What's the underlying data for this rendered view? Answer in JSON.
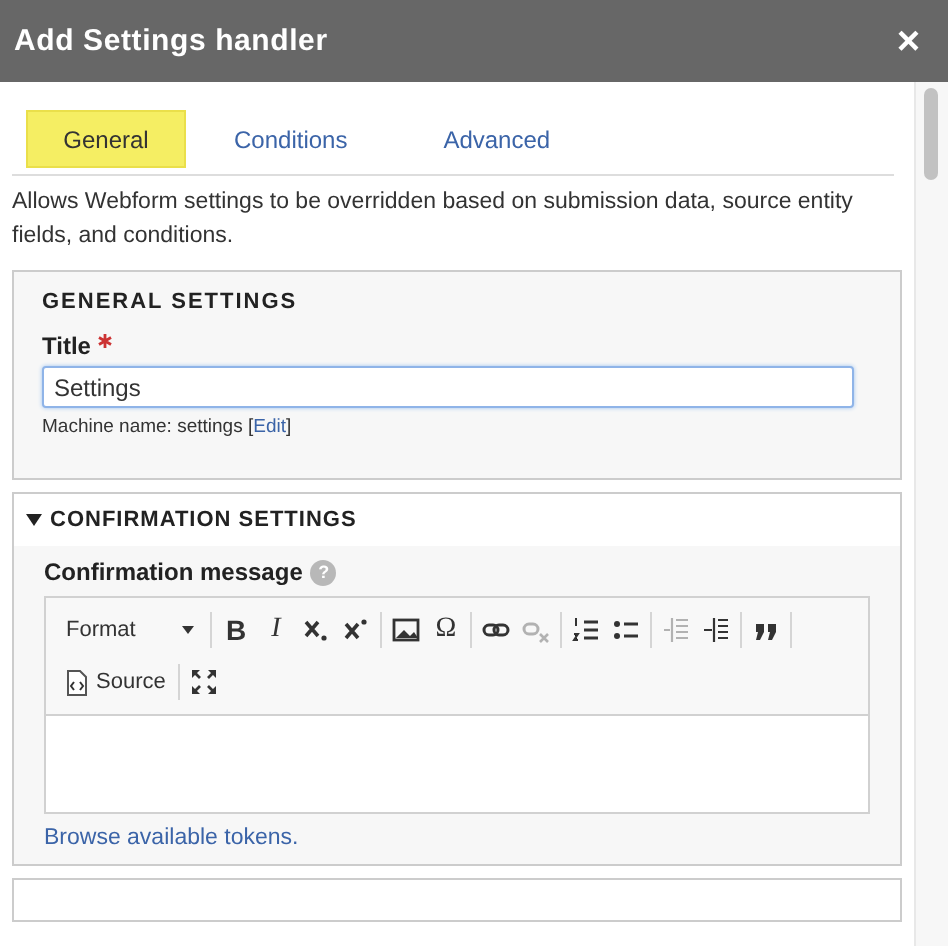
{
  "window": {
    "title": "Add Settings handler",
    "close": "×"
  },
  "tabs": [
    {
      "label": "General",
      "selected": true
    },
    {
      "label": "Conditions",
      "selected": false
    },
    {
      "label": "Advanced",
      "selected": false
    }
  ],
  "description": "Allows Webform settings to be overridden based on submission data, source entity fields, and conditions.",
  "general_settings": {
    "legend": "GENERAL SETTINGS",
    "title_label": "Title",
    "required": true,
    "title_value": "Settings",
    "machine_name": "Machine name: settings [",
    "edit_link": "Edit",
    "machine_name_end": "]"
  },
  "confirmation_settings": {
    "legend": "CONFIRMATION SETTINGS",
    "expanded": true,
    "message_label": "Confirmation message",
    "help": "?",
    "toolbar": [
      {
        "kind": "format",
        "label": "Format"
      },
      {
        "kind": "separator"
      },
      {
        "kind": "glyph",
        "label": "B",
        "disabled": false
      },
      {
        "kind": "glyph",
        "label": "I",
        "disabled": false
      },
      {
        "kind": "icon",
        "disabled": false
      },
      {
        "kind": "icon",
        "disabled": false
      },
      {
        "kind": "separator"
      },
      {
        "kind": "icon",
        "disabled": false
      },
      {
        "kind": "glyph",
        "label": "Ω",
        "disabled": false
      },
      {
        "kind": "separator"
      },
      {
        "kind": "icon",
        "disabled": false
      },
      {
        "kind": "icon",
        "disabled": true
      },
      {
        "kind": "separator"
      },
      {
        "kind": "icon",
        "disabled": false
      },
      {
        "kind": "icon",
        "disabled": false
      },
      {
        "kind": "separator"
      },
      {
        "kind": "icon",
        "disabled": true
      },
      {
        "kind": "icon",
        "disabled": false
      },
      {
        "kind": "separator"
      },
      {
        "kind": "icon",
        "disabled": false
      },
      {
        "kind": "separator"
      },
      {
        "kind": "break"
      },
      {
        "kind": "source",
        "label": "Source"
      },
      {
        "kind": "separator"
      },
      {
        "kind": "icon",
        "disabled": false
      }
    ],
    "tokens_link": "Browse available tokens."
  }
}
